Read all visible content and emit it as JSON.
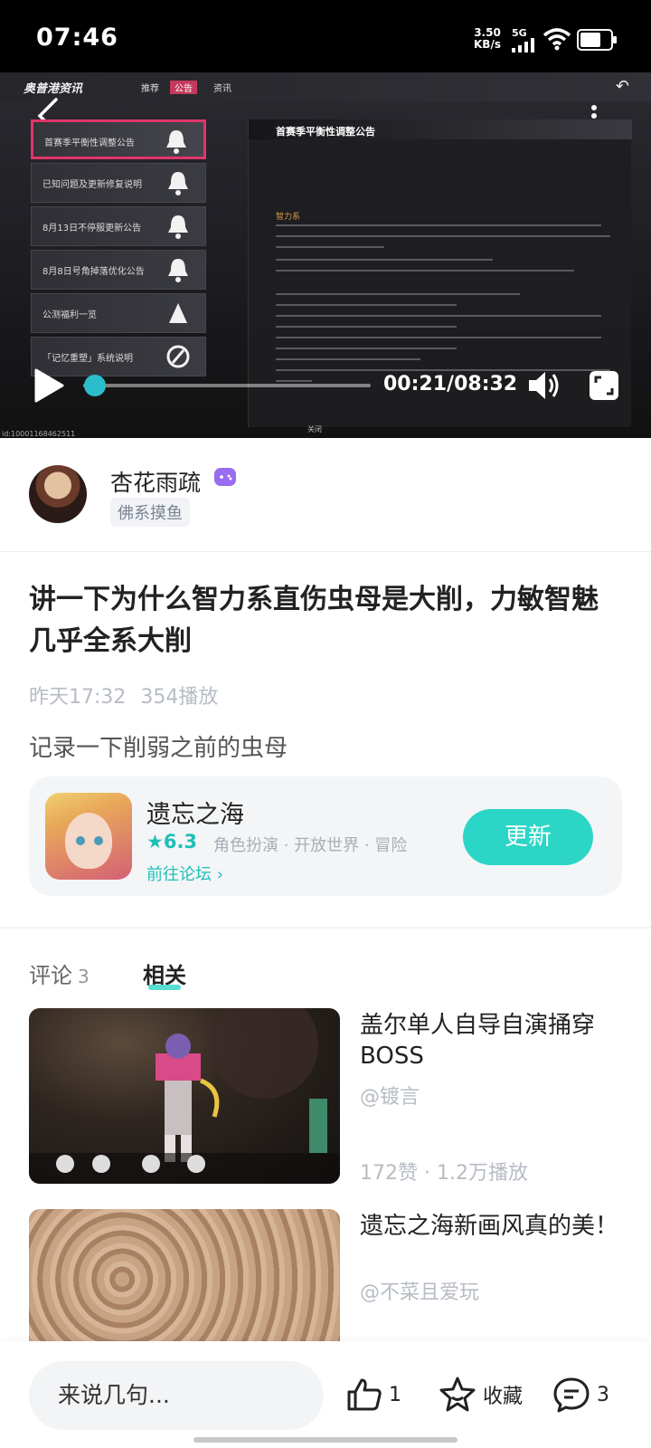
{
  "status_bar": {
    "time": "07:46",
    "net_speed_value": "3.50",
    "net_speed_unit": "KB/s",
    "network": "5G"
  },
  "video": {
    "game_header": {
      "title": "奥普港资讯",
      "tabs": [
        "推荐",
        "公告",
        "资讯"
      ],
      "active_tab": "公告"
    },
    "notice_list": [
      {
        "label": "首赛季平衡性调整公告",
        "active": true
      },
      {
        "label": "已知问题及更新修复说明",
        "active": false
      },
      {
        "label": "8月13日不停服更新公告",
        "active": false
      },
      {
        "label": "8月8日号角掉落优化公告",
        "active": false
      },
      {
        "label": "公测福利一览",
        "active": false
      },
      {
        "label": "「记忆重塑」系统说明",
        "active": false
      }
    ],
    "notice_title": "首赛季平衡性调整公告",
    "notice_subtitle": "智力系",
    "video_id": "id:10001168462511",
    "exit_label": "关闭",
    "current_time": "00:21",
    "duration": "08:32",
    "progress_fraction": 0.041,
    "accent_color": "#2bbdcc"
  },
  "author": {
    "name": "杏花雨疏",
    "tag": "佛系摸鱼"
  },
  "post": {
    "title": "讲一下为什么智力系直伤虫母是大削，力敏智魅几乎全系大削",
    "time": "昨天17:32",
    "plays": "354播放",
    "body": "记录一下削弱之前的虫母"
  },
  "game_card": {
    "name": "遗忘之海",
    "rating": "6.3",
    "tags": "角色扮演 · 开放世界 · 冒险",
    "forum_link": "前往论坛",
    "update_button": "更新",
    "button_color": "#2cd6c6"
  },
  "tabs": {
    "comments_label": "评论",
    "comments_count": "3",
    "related_label": "相关"
  },
  "related": [
    {
      "title": "盖尔单人自导自演捅穿BOSS",
      "author": "@镀言",
      "stats": "172赞 · 1.2万播放"
    },
    {
      "title": "遗忘之海新画风真的美！",
      "author": "@不菜且爱玩",
      "stats": ""
    }
  ],
  "bottom_bar": {
    "input_placeholder": "来说几句...",
    "like_count": "1",
    "favorite_label": "收藏",
    "comment_count": "3"
  }
}
